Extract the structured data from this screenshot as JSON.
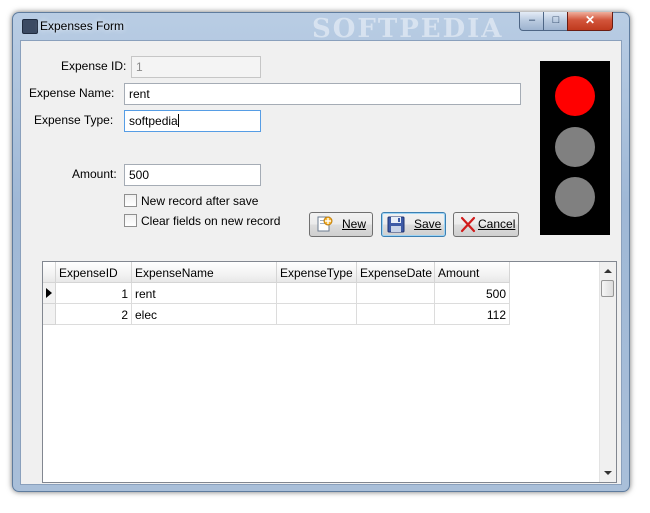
{
  "window": {
    "title": "Expenses Form",
    "watermark": "SOFTPEDIA",
    "controls": {
      "minimize": "–",
      "maximize": "□",
      "close": "✕"
    }
  },
  "form": {
    "expense_id_label": "Expense ID:",
    "expense_id_value": "1",
    "expense_name_label": "Expense Name:",
    "expense_name_value": "rent",
    "expense_type_label": "Expense Type:",
    "expense_type_value": "softpedia",
    "amount_label": "Amount:",
    "amount_value": "500",
    "new_record_after_save_label": "New record after save",
    "clear_fields_label": "Clear fields on new record"
  },
  "buttons": {
    "new_label": "New",
    "save_label": "Save",
    "cancel_label": "Cancel"
  },
  "icons": {
    "app": "app-icon",
    "new": "new-document-icon",
    "save": "floppy-disk-icon",
    "cancel": "red-x-icon"
  },
  "traffic_light": {
    "active": "red",
    "colors": {
      "red": "#ff0000",
      "off": "#808080"
    }
  },
  "grid": {
    "columns": [
      "ExpenseID",
      "ExpenseName",
      "ExpenseType",
      "ExpenseDate",
      "Amount"
    ],
    "rows": [
      {
        "id": "1",
        "name": "rent",
        "type": "",
        "date": "",
        "amount": "500"
      },
      {
        "id": "2",
        "name": "elec",
        "type": "",
        "date": "",
        "amount": "112"
      }
    ]
  }
}
